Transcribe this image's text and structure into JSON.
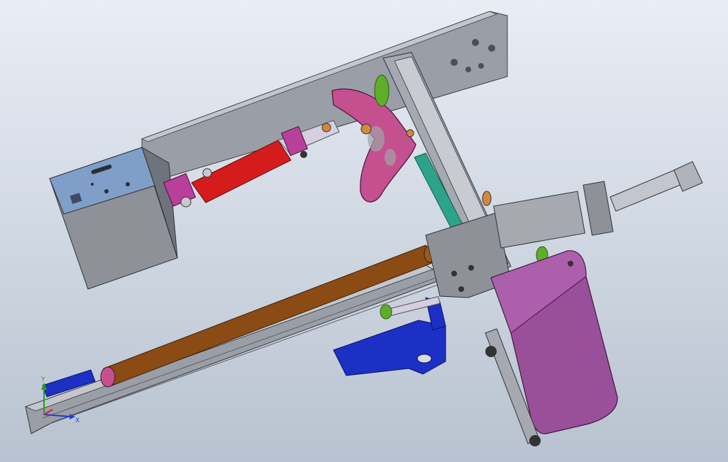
{
  "viewport": {
    "background_top": "#e9eef5",
    "background_bottom": "#b8c2d0"
  },
  "triad": {
    "x_label": "X",
    "y_label": "Y",
    "x_color": "#1f3fd6",
    "y_color": "#1fa01f",
    "z_color": "#d61f1f"
  },
  "model": {
    "kind": "3D CAD assembly — pick-and-place manipulator",
    "colors": {
      "steel": "#9a9ea6",
      "steel_dark": "#6f737b",
      "pink_arm": "#c4508f",
      "purple_motor": "#9a4f9a",
      "red_cylinder": "#d41c1c",
      "brown_rod": "#8a4c14",
      "blue_bracket": "#1c30c6",
      "teal_strip": "#2da38c",
      "green_spring": "#5fae2a"
    }
  }
}
